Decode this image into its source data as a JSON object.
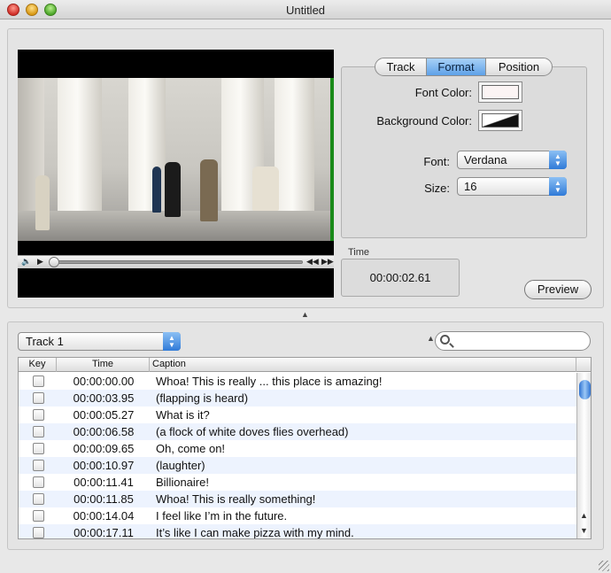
{
  "window": {
    "title": "Untitled"
  },
  "format_tabs": [
    {
      "label": "Track",
      "active": false
    },
    {
      "label": "Format",
      "active": true
    },
    {
      "label": "Position",
      "active": false
    }
  ],
  "format": {
    "font_color_label": "Font Color:",
    "font_color": "#fbf4f4",
    "background_color_label": "Background Color:",
    "font_label": "Font:",
    "font_value": "Verdana",
    "size_label": "Size:",
    "size_value": "16"
  },
  "player": {
    "time_label": "Time",
    "time_value": "00:00:02.61",
    "playback_position": 0.0,
    "controls": [
      "volume-icon",
      "play-icon",
      "step-back-icon",
      "step-forward-icon"
    ]
  },
  "preview_label": "Preview",
  "track_select": {
    "selected": "Track 1"
  },
  "search": {
    "placeholder": ""
  },
  "table": {
    "columns": [
      "Key",
      "Time",
      "Caption"
    ],
    "rows": [
      {
        "time": "00:00:00.00",
        "caption": "Whoa! This is really ... this place is amazing!"
      },
      {
        "time": "00:00:03.95",
        "caption": "(flapping is heard)"
      },
      {
        "time": "00:00:05.27",
        "caption": "What is it?"
      },
      {
        "time": "00:00:06.58",
        "caption": "(a flock of white doves flies overhead)"
      },
      {
        "time": "00:00:09.65",
        "caption": "Oh, come on!"
      },
      {
        "time": "00:00:10.97",
        "caption": "(laughter)"
      },
      {
        "time": "00:00:11.41",
        "caption": "Billionaire!"
      },
      {
        "time": "00:00:11.85",
        "caption": "Whoa! This is really something!"
      },
      {
        "time": "00:00:14.04",
        "caption": "I feel like I’m in the future."
      },
      {
        "time": "00:00:17.11",
        "caption": "It’s like I can make pizza with my mind."
      }
    ]
  },
  "colors": {
    "accent": "#5ea1e8",
    "row_alt": "#edf3fe",
    "video_edge": "#1a8b1a"
  }
}
